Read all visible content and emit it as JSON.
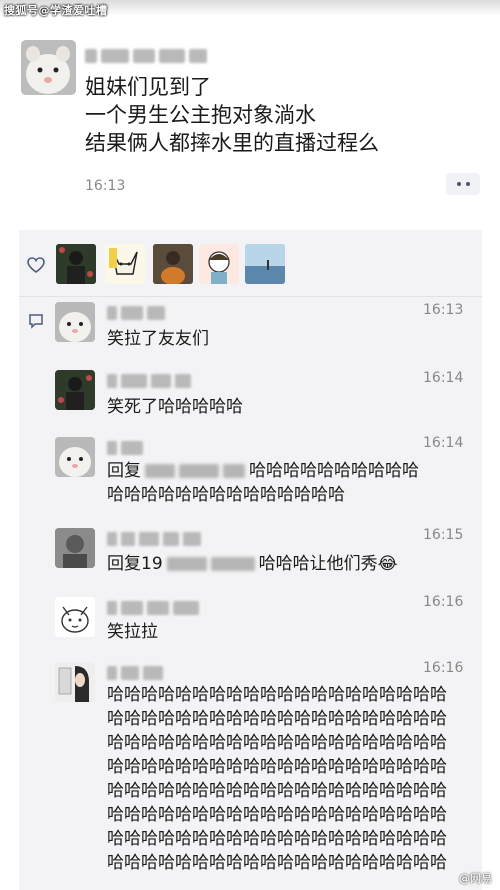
{
  "watermark_top": "搜狐号@学渣爱吐槽",
  "post": {
    "lines": [
      "姐妹们见到了",
      "一个男生公主抱对象淌水",
      "结果俩人都摔水里的直播过程么"
    ],
    "time": "16:13"
  },
  "icons": {
    "like": "heart-outline-icon",
    "comment": "comment-icon",
    "more": "more-dots-icon"
  },
  "comments": [
    {
      "time": "16:13",
      "lines": [
        "笑拉了友友们"
      ]
    },
    {
      "time": "16:14",
      "lines": [
        "笑死了哈哈哈哈哈"
      ]
    },
    {
      "time": "16:14",
      "prefix": "回复",
      "lines": [
        "哈哈哈哈哈哈哈哈哈哈",
        "哈哈哈哈哈哈哈哈哈哈哈哈哈哈"
      ]
    },
    {
      "time": "16:15",
      "prefix": "回复19",
      "suffix": "哈哈哈让他们秀😂"
    },
    {
      "time": "16:16",
      "lines": [
        "笑拉拉"
      ]
    },
    {
      "time": "16:16",
      "lines": [
        "哈哈哈哈哈哈哈哈哈哈哈哈哈哈哈哈哈哈哈哈",
        "哈哈哈哈哈哈哈哈哈哈哈哈哈哈哈哈哈哈哈哈",
        "哈哈哈哈哈哈哈哈哈哈哈哈哈哈哈哈哈哈哈哈",
        "哈哈哈哈哈哈哈哈哈哈哈哈哈哈哈哈哈哈哈哈",
        "哈哈哈哈哈哈哈哈哈哈哈哈哈哈哈哈哈哈哈哈",
        "哈哈哈哈哈哈哈哈哈哈哈哈哈哈哈哈哈哈哈哈",
        "哈哈哈哈哈哈哈哈哈哈哈哈哈哈哈哈哈哈哈哈",
        "哈哈哈哈哈哈哈哈哈哈哈哈哈哈哈哈哈哈哈哈"
      ]
    }
  ],
  "watermark_bottom": "@网易"
}
